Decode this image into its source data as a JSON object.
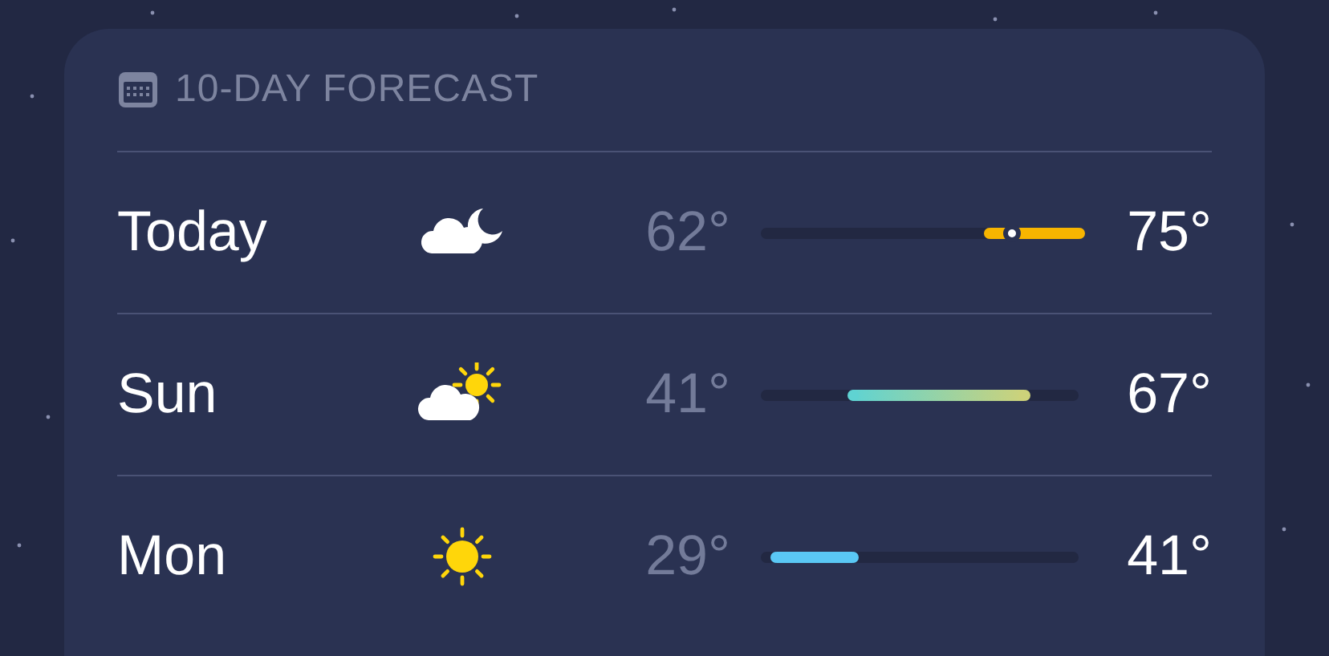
{
  "forecast": {
    "title": "10-DAY FORECAST",
    "days": [
      {
        "day": "Today",
        "kind": "moon-cloud",
        "low": "62°",
        "high": "75°",
        "range": {
          "low": {
            "level": 0.72,
            "color": "#f7b500"
          },
          "high": {
            "level": 1.0,
            "color": "#f7b500"
          }
        },
        "now_marker": {
          "level": 0.79
        }
      },
      {
        "day": "Sun",
        "kind": "sun-cloud",
        "low": "41°",
        "high": "67°",
        "range": {
          "low": {
            "level": 0.29,
            "color": "#5fd3d2"
          },
          "high": {
            "level": 0.83,
            "color": "#cdd27a"
          }
        }
      },
      {
        "day": "Mon",
        "kind": "sun",
        "low": "29°",
        "high": "41°",
        "range": {
          "low": {
            "level": 0.05,
            "color": "#5ac8f5"
          },
          "high": {
            "level": 0.29,
            "color": "#5ac8f5"
          }
        }
      }
    ]
  }
}
